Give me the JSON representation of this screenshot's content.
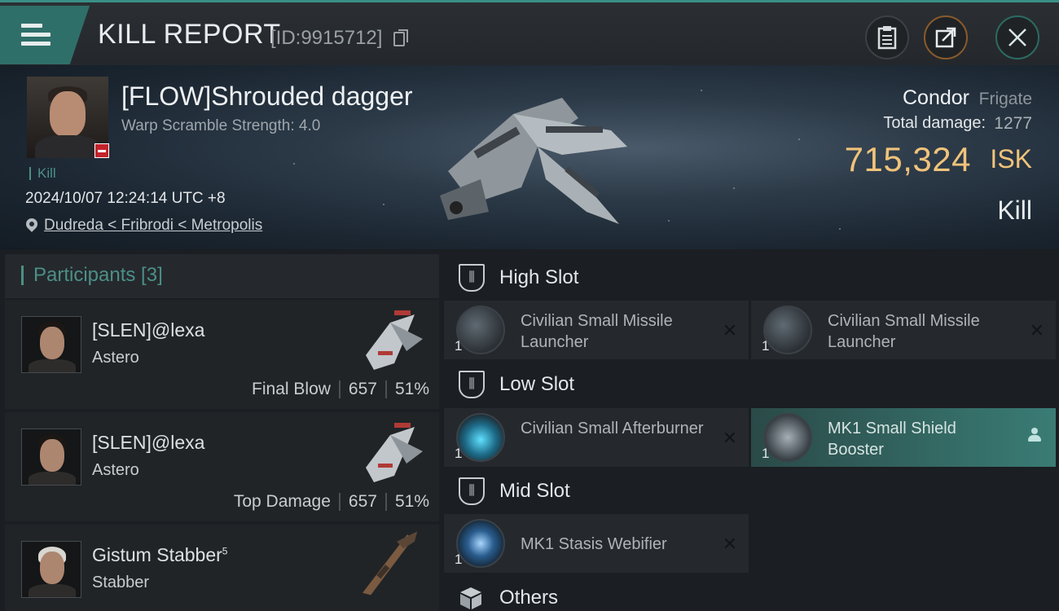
{
  "header": {
    "title": "KILL REPORT",
    "report_id": "[ID:9915712]"
  },
  "victim": {
    "name": "[FLOW]Shrouded dagger",
    "scramble": "Warp Scramble Strength: 4.0",
    "kill_tag": "Kill",
    "time": "2024/10/07 12:24:14 UTC +8",
    "location": "Dudreda < Fribrodi < Metropolis",
    "ship_name": "Condor",
    "ship_class": "Frigate",
    "total_damage_label": "Total damage:",
    "total_damage": "1277",
    "isk_value": "715,324",
    "isk_unit": "ISK",
    "result": "Kill"
  },
  "participants": {
    "header": "Participants [3]",
    "rows": [
      {
        "name": "[SLEN]@lexa",
        "ship": "Astero",
        "role": "Final Blow",
        "damage": "657",
        "percent": "51%"
      },
      {
        "name": "[SLEN]@lexa",
        "ship": "Astero",
        "role": "Top Damage",
        "damage": "657",
        "percent": "51%"
      },
      {
        "name": "Gistum Stabber",
        "sup": "5",
        "ship": "Stabber"
      }
    ]
  },
  "fitting": {
    "high_slot": "High Slot",
    "low_slot": "Low Slot",
    "mid_slot": "Mid Slot",
    "others": "Others",
    "high": [
      {
        "qty": "1",
        "name": "Civilian Small Missile Launcher"
      },
      {
        "qty": "1",
        "name": "Civilian Small Missile Launcher"
      }
    ],
    "low": [
      {
        "qty": "1",
        "name": "Civilian Small Afterburner"
      },
      {
        "qty": "1",
        "name": "MK1 Small Shield Booster"
      }
    ],
    "mid": [
      {
        "qty": "1",
        "name": "MK1 Stasis Webifier"
      }
    ]
  },
  "colors": {
    "accent_teal": "#4c8f87",
    "isk_gold": "#f0c37a",
    "loss_red": "#c3232b"
  },
  "icons": [
    "menu-icon",
    "copy-icon",
    "clipboard-icon",
    "share-icon",
    "close-icon",
    "location-pin-icon",
    "slot-icon",
    "cube-icon",
    "close-x-icon",
    "person-icon"
  ]
}
